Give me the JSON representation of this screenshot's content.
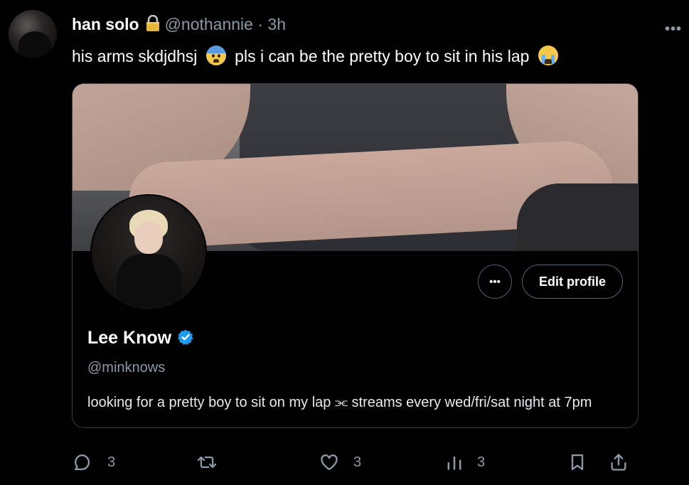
{
  "tweet": {
    "author_name": "han solo",
    "handle": "@nothannie",
    "separator": "·",
    "time": "3h",
    "text_part1": "his arms skdjdhsj",
    "text_part2": "pls i can be the pretty boy to sit in his lap"
  },
  "card": {
    "edit_button": "Edit profile",
    "more_button": "•••",
    "display_name": "Lee Know",
    "handle": "@minknows",
    "bio": "looking for a pretty boy to sit on my lap ⫘ streams every wed/fri/sat night at 7pm"
  },
  "actions": {
    "replies": "3",
    "likes": "3",
    "views": "3"
  },
  "icons": [
    "lock-icon",
    "more-icon",
    "scared-emoji",
    "crying-emoji",
    "verified-badge-icon",
    "reply-icon",
    "retweet-icon",
    "like-icon",
    "views-icon",
    "bookmark-icon",
    "share-icon"
  ],
  "colors": {
    "background": "#000000",
    "text": "#e7e9ea",
    "secondary": "#8b98a5",
    "verified": "#1d9bf0",
    "border": "#3a3e42"
  }
}
